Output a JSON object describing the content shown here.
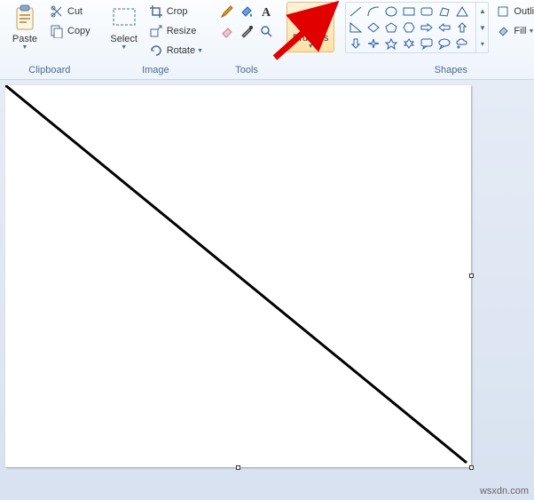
{
  "ribbon": {
    "clipboard": {
      "title": "Clipboard",
      "paste": "Paste",
      "cut": "Cut",
      "copy": "Copy"
    },
    "image": {
      "title": "Image",
      "select": "Select",
      "crop": "Crop",
      "resize": "Resize",
      "rotate": "Rotate"
    },
    "tools": {
      "title": "Tools"
    },
    "brushes": {
      "title": "Brushes"
    },
    "shapes": {
      "title": "Shapes",
      "outline": "Outline",
      "fill": "Fill"
    }
  },
  "watermark": "wsxdn.com"
}
